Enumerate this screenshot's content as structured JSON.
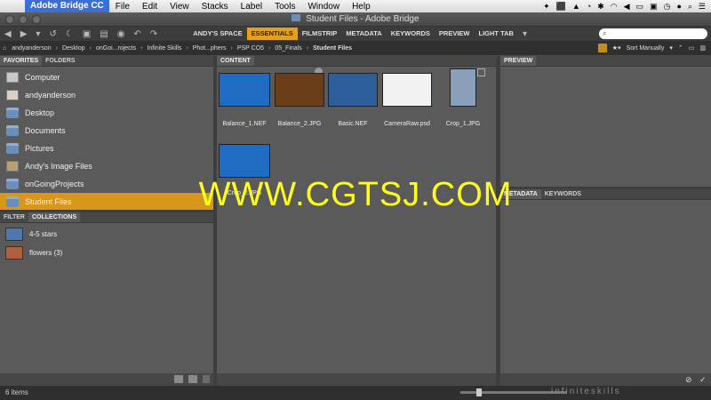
{
  "menubar": {
    "apple": "",
    "app_name": "Adobe Bridge CC",
    "items": [
      "File",
      "Edit",
      "View",
      "Stacks",
      "Label",
      "Tools",
      "Window",
      "Help"
    ]
  },
  "window": {
    "title": "Student Files - Adobe Bridge"
  },
  "workspaces": [
    "ANDY'S SPACE",
    "ESSENTIALS",
    "FILMSTRIP",
    "METADATA",
    "KEYWORDS",
    "PREVIEW",
    "LIGHT TAB"
  ],
  "active_workspace": "ESSENTIALS",
  "search": {
    "placeholder": ""
  },
  "breadcrumb": [
    "andyanderson",
    "Desktop",
    "onGoi...rojects",
    "Infinite Skills",
    "Phot...phers",
    "PSP CO5",
    "05_Finals",
    "Student Files"
  ],
  "sort": {
    "label": "Sort Manually"
  },
  "left_top_tabs": [
    "FAVORITES",
    "FOLDERS"
  ],
  "favorites": [
    {
      "label": "Computer",
      "icon": "computer-icon"
    },
    {
      "label": "andyanderson",
      "icon": "home-icon"
    },
    {
      "label": "Desktop",
      "icon": "folder-icon"
    },
    {
      "label": "Documents",
      "icon": "folder-icon"
    },
    {
      "label": "Pictures",
      "icon": "folder-icon"
    },
    {
      "label": "Andy's Image Files",
      "icon": "user-folder-icon"
    },
    {
      "label": "onGoingProjects",
      "icon": "folder-icon"
    },
    {
      "label": "Student Files",
      "icon": "folder-icon",
      "selected": true
    }
  ],
  "left_bottom_tabs": [
    "FILTER",
    "COLLECTIONS"
  ],
  "collections": [
    {
      "label": "4-5 stars",
      "color": "#4f78b0"
    },
    {
      "label": "flowers (3)",
      "color": "#b06040"
    }
  ],
  "content": {
    "tab": "CONTENT",
    "items": [
      {
        "name": "Balance_1.NEF",
        "color": "#1f6cc4"
      },
      {
        "name": "Balance_2.JPG",
        "color": "#7a4a20"
      },
      {
        "name": "Basic.NEF",
        "color": "#2d5f9a"
      },
      {
        "name": "CameraRaw.psd",
        "color": "#f2f2f2"
      },
      {
        "name": "Crop_1.JPG",
        "color": "#8aa0b8"
      },
      {
        "name": "Crop_2.JPG",
        "color": "#1f6cc4"
      }
    ]
  },
  "preview": {
    "tab": "PREVIEW"
  },
  "metadata_tabs": [
    "METADATA",
    "KEYWORDS"
  ],
  "status": {
    "item_count": "6 items"
  },
  "watermark": "WWW.CGTSJ.COM",
  "watermark2": "infiniteskills"
}
